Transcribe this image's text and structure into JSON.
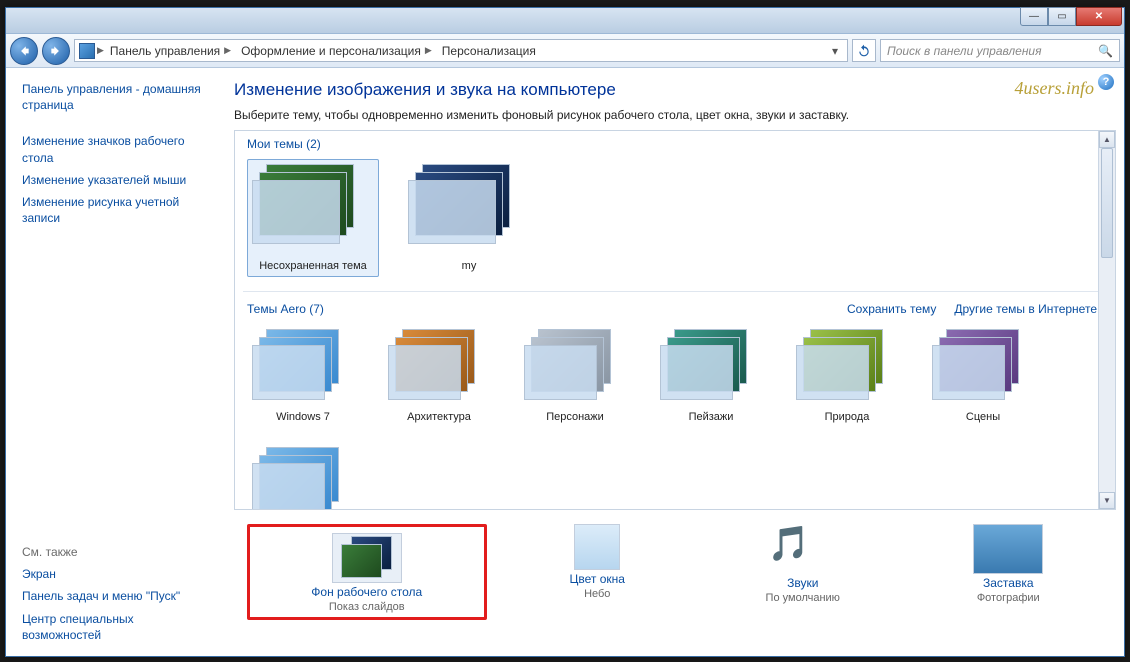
{
  "breadcrumb": {
    "items": [
      "Панель управления",
      "Оформление и персонализация",
      "Персонализация"
    ]
  },
  "search": {
    "placeholder": "Поиск в панели управления"
  },
  "sidebar": {
    "home": "Панель управления - домашняя страница",
    "links": [
      "Изменение значков рабочего стола",
      "Изменение указателей мыши",
      "Изменение рисунка учетной записи"
    ],
    "also_title": "См. также",
    "also": [
      "Экран",
      "Панель задач и меню \"Пуск\"",
      "Центр специальных возможностей"
    ]
  },
  "watermark": "4users.info",
  "page": {
    "title": "Изменение изображения и звука на компьютере",
    "subtitle": "Выберите тему, чтобы одновременно изменить фоновый рисунок рабочего стола, цвет окна, звуки и заставку."
  },
  "groups": {
    "my": {
      "label": "Мои темы (2)",
      "themes": [
        "Несохраненная тема",
        "my"
      ]
    },
    "aero": {
      "label": "Темы Aero (7)",
      "themes": [
        "Windows 7",
        "Архитектура",
        "Персонажи",
        "Пейзажи",
        "Природа",
        "Сцены"
      ],
      "links": {
        "save": "Сохранить тему",
        "more": "Другие темы в Интернете"
      }
    }
  },
  "bottom": {
    "items": [
      {
        "title": "Фон рабочего стола",
        "sub": "Показ слайдов"
      },
      {
        "title": "Цвет окна",
        "sub": "Небо"
      },
      {
        "title": "Звуки",
        "sub": "По умолчанию"
      },
      {
        "title": "Заставка",
        "sub": "Фотографии"
      }
    ]
  }
}
